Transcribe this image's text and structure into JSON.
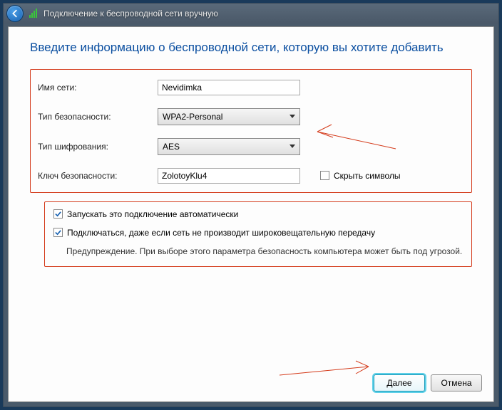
{
  "titlebar": {
    "text": "Подключение к беспроводной сети вручную"
  },
  "heading": "Введите информацию о беспроводной сети, которую вы хотите добавить",
  "form": {
    "name_label": "Имя сети:",
    "name_value": "Nevidimka",
    "sec_label": "Тип безопасности:",
    "sec_value": "WPA2-Personal",
    "enc_label": "Тип шифрования:",
    "enc_value": "AES",
    "key_label": "Ключ безопасности:",
    "key_value": "ZolotoyKlu4",
    "hide_label": "Скрыть символы"
  },
  "auto": {
    "autostart_label": "Запускать это подключение автоматически",
    "broadcast_label": "Подключаться, даже если сеть не производит широковещательную передачу",
    "warning": "Предупреждение. При выборе этого параметра безопасность компьютера может быть под угрозой."
  },
  "footer": {
    "next": "Далее",
    "cancel": "Отмена"
  }
}
